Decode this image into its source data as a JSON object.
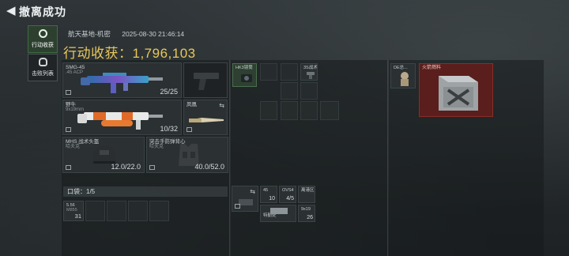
{
  "header": {
    "title": "撤离成功"
  },
  "tabs": [
    {
      "label": "行动收获",
      "active": true
    },
    {
      "label": "击败列表",
      "active": false
    }
  ],
  "info": {
    "map": "航天基地-机密",
    "datetime": "2025-08-30 21:46:14"
  },
  "earnings": {
    "text": "行动收获：1,796,103"
  },
  "weapons": [
    {
      "name": "SMG-45",
      "sub": ".45 ACP",
      "count": "25/25"
    },
    {
      "name": "",
      "sub": "",
      "count": ""
    },
    {
      "name": "野牛",
      "sub": "9x19mm",
      "count": "10/32"
    },
    {
      "name": "凤凰",
      "sub": "",
      "count": ""
    }
  ],
  "armor": [
    {
      "name": "MHS 战术头盔",
      "sub": "哈夫克",
      "durability": "12.0/22.0"
    },
    {
      "name": "突击手防弹背心",
      "sub": "哈夫克",
      "durability": "40.0/52.0"
    }
  ],
  "pocket": {
    "label": "口袋：1/5",
    "items": [
      {
        "name": "5.56",
        "sub": "M855",
        "count": "31"
      }
    ]
  },
  "rig": {
    "items": [
      {
        "name": "HK3镜筒",
        "sub": ""
      },
      {
        "name": "3S战术",
        "sub": ""
      }
    ]
  },
  "backpack": {
    "items": [
      {
        "name": "45",
        "count": "10"
      },
      {
        "name": "OVS4",
        "count": "4/5"
      },
      {
        "name": "离港区",
        "count": ""
      },
      {
        "name": "特勤处",
        "count": ""
      },
      {
        "name": "9x19",
        "count": "26"
      }
    ]
  },
  "safebox": {
    "items": [
      {
        "name": "DE总...",
        "sub": ""
      },
      {
        "name": "火箭燃料",
        "sub": ""
      }
    ]
  },
  "colors": {
    "accent_gold": "#e8c85a",
    "active_tab": "#2d4030",
    "red_item": "#5a1e1c"
  }
}
